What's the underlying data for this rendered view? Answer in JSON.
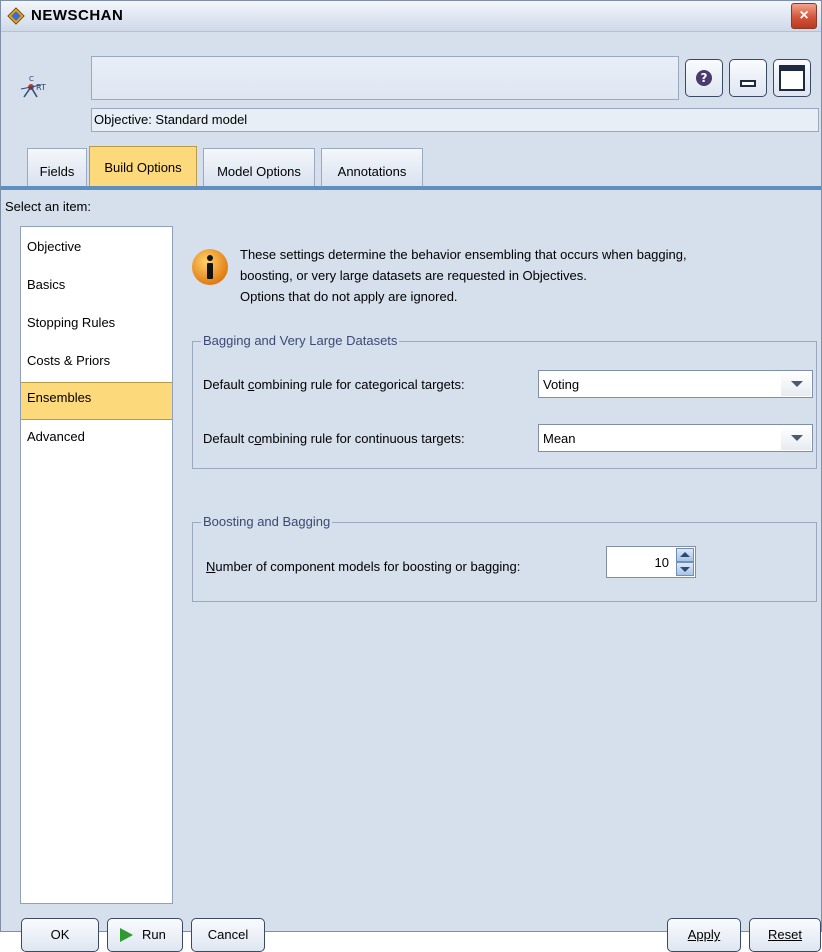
{
  "window": {
    "title": "NEWSCHAN",
    "close_glyph": "×"
  },
  "header": {
    "objective_text": "Objective: Standard model"
  },
  "tabs": [
    {
      "label": "Fields"
    },
    {
      "label": "Build Options"
    },
    {
      "label": "Model Options"
    },
    {
      "label": "Annotations"
    }
  ],
  "sidebar": {
    "select_label": "Select an item:",
    "items": [
      {
        "label": "Objective"
      },
      {
        "label": "Basics"
      },
      {
        "label": "Stopping Rules"
      },
      {
        "label": "Costs & Priors"
      },
      {
        "label": "Ensembles"
      },
      {
        "label": "Advanced"
      }
    ],
    "selected": "Ensembles"
  },
  "info": {
    "line1": "These settings determine the behavior ensembling that occurs when bagging,",
    "line2": "boosting, or very large datasets are requested in Objectives.",
    "line3": "Options  that do not apply are ignored."
  },
  "bagging_group": {
    "title": "Bagging and Very Large Datasets",
    "categorical_label": "Default combining rule for categorical targets:",
    "categorical_value": "Voting",
    "continuous_label": "Default combining rule for continuous targets:",
    "continuous_value": "Mean"
  },
  "boosting_group": {
    "title": "Boosting and Bagging",
    "components_label": "Number of component models for boosting or bagging:",
    "components_value": "10"
  },
  "buttons": {
    "ok": "OK",
    "run": "Run",
    "cancel": "Cancel",
    "apply": "Apply",
    "reset": "Reset"
  },
  "colors": {
    "accent_selected": "#fcd97a",
    "tab_rule": "#5f8fbf",
    "group_title": "#3b4a73"
  }
}
